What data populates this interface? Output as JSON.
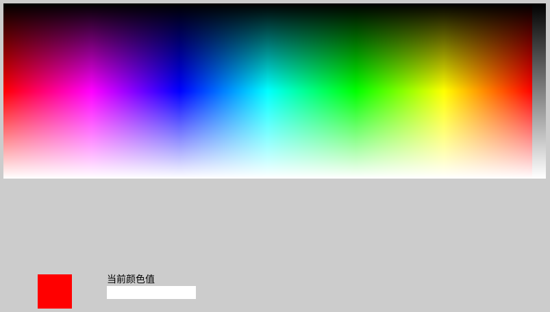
{
  "picker": {
    "hue_stops": [
      "#ff0000",
      "#ff00ff",
      "#0000ff",
      "#00ffff",
      "#00ff00",
      "#ffff00",
      "#ff0000"
    ],
    "lightness_stops": [
      "#000000",
      "#ffffff"
    ]
  },
  "current_color": {
    "swatch_color": "#ff0000",
    "label": "当前颜色值",
    "value": ""
  }
}
